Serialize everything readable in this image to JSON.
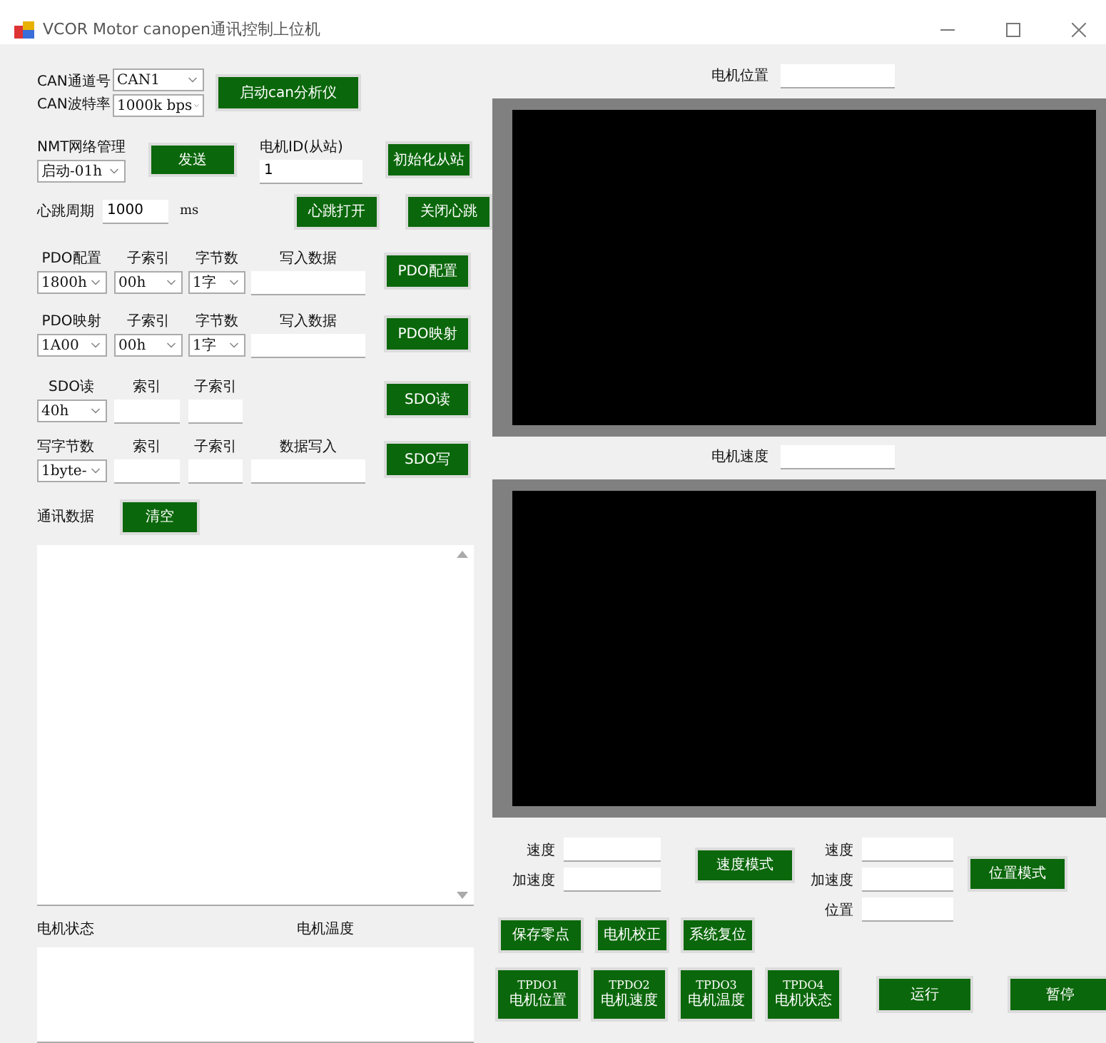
{
  "window": {
    "title": "VCOR Motor canopen通讯控制上位机"
  },
  "can": {
    "channel_label": "CAN通道号",
    "channel": "CAN1",
    "baud_label": "CAN波特率",
    "baud": "1000k bps",
    "start_button": "启动can分析仪"
  },
  "nmt": {
    "label": "NMT网络管理",
    "value": "启动-01h",
    "send_button": "发送",
    "id_label": "电机ID(从站)",
    "id_value": "1",
    "init_button": "初始化从站"
  },
  "heartbeat": {
    "label": "心跳周期",
    "value": "1000",
    "unit": "ms",
    "open_button": "心跳打开",
    "close_button": "关闭心跳"
  },
  "pdo_rows": [
    {
      "label": "PDO配置",
      "value": "1800h",
      "sub_label": "子索引",
      "sub": "00h",
      "bytes_label": "字节数",
      "bytes": "1字",
      "data_label": "写入数据",
      "button": "PDO配置"
    },
    {
      "label": "PDO映射",
      "value": "1A00",
      "sub_label": "子索引",
      "sub": "00h",
      "bytes_label": "字节数",
      "bytes": "1字",
      "data_label": "写入数据",
      "button": "PDO映射"
    }
  ],
  "sdo_read": {
    "label": "SDO读",
    "value": "40h",
    "index_label": "索引",
    "sub_label": "子索引",
    "button": "SDO读"
  },
  "sdo_write": {
    "label": "写字节数",
    "value": "1byte-",
    "index_label": "索引",
    "sub_label": "子索引",
    "data_label": "数据写入",
    "button": "SDO写"
  },
  "comm": {
    "label": "通讯数据",
    "clear_button": "清空"
  },
  "status": {
    "state_label": "电机状态",
    "temp_label": "电机温度"
  },
  "position_plot": {
    "label": "电机位置"
  },
  "speed_plot": {
    "label": "电机速度"
  },
  "speed_mode": {
    "speed_label": "速度",
    "accel_label": "加速度",
    "button": "速度模式"
  },
  "position_mode": {
    "speed_label": "速度",
    "accel_label": "加速度",
    "position_label": "位置",
    "button": "位置模式"
  },
  "actions": [
    "保存零点",
    "电机校正",
    "系统复位"
  ],
  "tpdo_buttons": [
    {
      "code": "TPDO1",
      "label": "电机位置"
    },
    {
      "code": "TPDO2",
      "label": "电机速度"
    },
    {
      "code": "TPDO3",
      "label": "电机温度"
    },
    {
      "code": "TPDO4",
      "label": "电机状态"
    }
  ],
  "run_button": "运行",
  "pause_button": "暂停"
}
